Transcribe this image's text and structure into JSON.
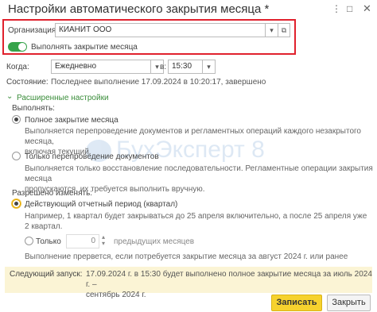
{
  "window": {
    "title": "Настройки автоматического закрытия месяца *",
    "more_glyph": "⋮",
    "max_glyph": "□",
    "close_glyph": "✕"
  },
  "org": {
    "label": "Организация:",
    "value": "КИАНИТ ООО",
    "dropdown_glyph": "▾",
    "open_glyph": "⧉"
  },
  "toggle": {
    "label": "Выполнять закрытие месяца",
    "on": true
  },
  "when": {
    "label": "Когда:",
    "value": "Ежедневно",
    "at_label": "в:",
    "time": "15:30",
    "dropdown_glyph": "▾"
  },
  "status": {
    "label": "Состояние:",
    "value": "Последнее выполнение 17.09.2024 в 10:20:17, завершено"
  },
  "advanced": {
    "label": "Расширенные настройки",
    "chevron": "⌄"
  },
  "perform": {
    "label": "Выполнять:",
    "options": [
      {
        "label": "Полное закрытие месяца",
        "desc_line1": "Выполняется перепроведение документов и регламентных операций каждого незакрытого месяца,",
        "desc_line2": "включая текущий."
      },
      {
        "label": "Только перепроведение документов",
        "desc_line1": "Выполняется только восстановление последовательности. Регламентные операции закрытия месяца",
        "desc_line2": "пропускаются, их требуется выполнить вручную."
      }
    ]
  },
  "allow": {
    "label": "Разрешено изменять:",
    "opt_current": "Действующий отчетный период (квартал)",
    "current_desc_line1": "Например, 1 квартал будет закрываться до 25 апреля включительно, а после 25 апреля уже",
    "current_desc_line2": "2 квартал.",
    "opt_only": "Только",
    "only_count": "0",
    "only_suffix": "предыдущих месяцев",
    "only_desc": "Выполнение прервется, если потребуется закрытие месяца за август 2024 г. или ранее"
  },
  "next_run": {
    "label": "Следующий запуск:",
    "value_line1": "17.09.2024 г. в 15:30 будет выполнено полное закрытие месяца за июль 2024 г. –",
    "value_line2": "сентябрь 2024 г."
  },
  "buttons": {
    "save": "Записать",
    "close": "Закрыть"
  },
  "watermark": {
    "text": "БухЭксперт 8"
  },
  "colors": {
    "accent_green": "#36a34a",
    "highlight_red": "#e0212d",
    "primary_yellow": "#f6d22e"
  }
}
